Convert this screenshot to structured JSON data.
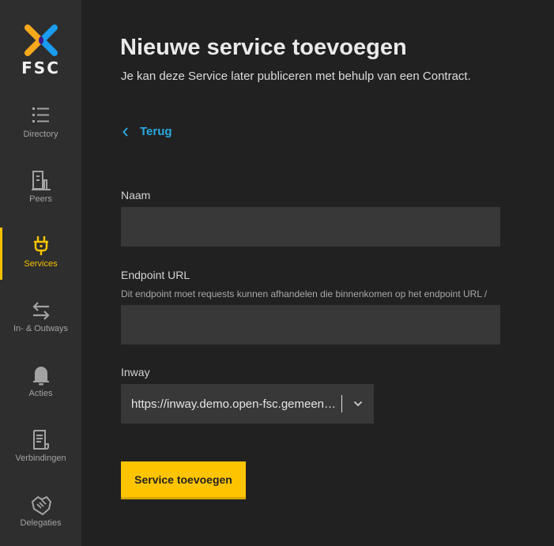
{
  "brand": {
    "name": "FSC",
    "colors": {
      "orange": "#f7a81b",
      "blue": "#1a9cf0",
      "center": "#3b1a8c"
    }
  },
  "sidebar": {
    "active_color": "#f5c200",
    "items": [
      {
        "label": "Directory",
        "icon": "list-icon",
        "active": false
      },
      {
        "label": "Peers",
        "icon": "building-icon",
        "active": false
      },
      {
        "label": "Services",
        "icon": "plug-icon",
        "active": true
      },
      {
        "label": "In- & Outways",
        "icon": "arrows-left-right-icon",
        "active": false
      },
      {
        "label": "Acties",
        "icon": "bell-icon",
        "active": false
      },
      {
        "label": "Verbindingen",
        "icon": "document-icon",
        "active": false
      },
      {
        "label": "Delegaties",
        "icon": "handshake-icon",
        "active": false
      }
    ]
  },
  "page": {
    "title": "Nieuwe service toevoegen",
    "subtitle": "Je kan deze Service later publiceren met behulp van een Contract.",
    "back_label": "Terug"
  },
  "form": {
    "name": {
      "label": "Naam",
      "value": "",
      "placeholder": ""
    },
    "endpoint": {
      "label": "Endpoint URL",
      "hint": "Dit endpoint moet requests kunnen afhandelen die binnenkomen op het endpoint URL /",
      "value": "",
      "placeholder": ""
    },
    "inway": {
      "label": "Inway",
      "selected": "https://inway.demo.open-fsc.gemeente-stijns.nl"
    },
    "submit_label": "Service toevoegen"
  }
}
